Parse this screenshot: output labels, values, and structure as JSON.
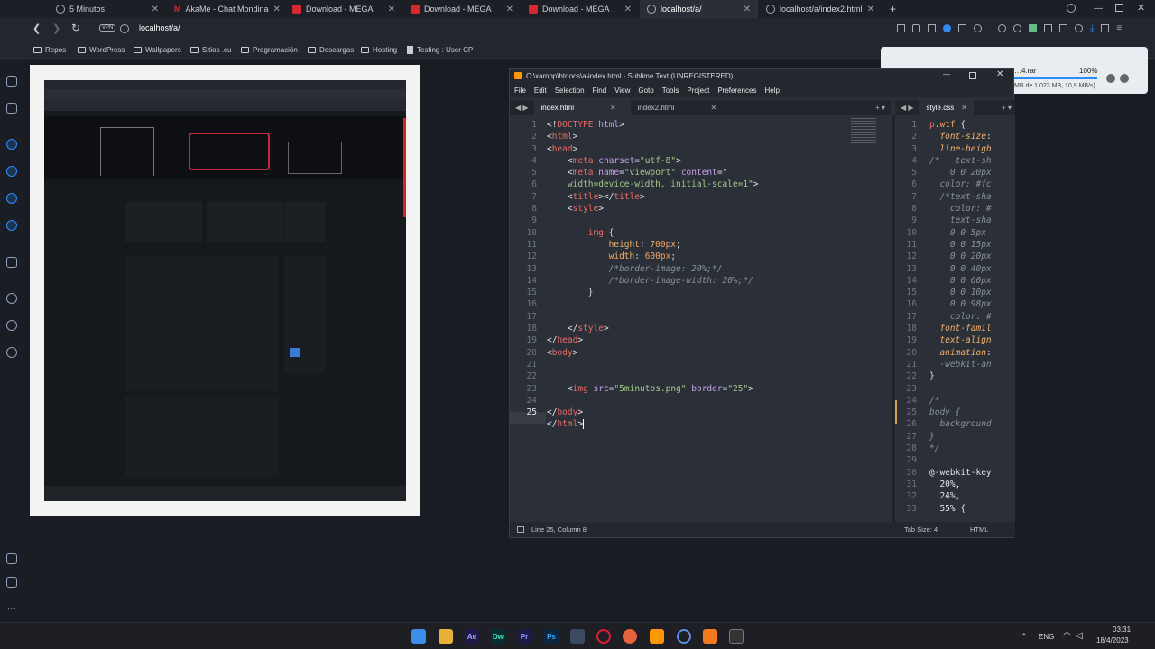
{
  "browser": {
    "tabs": [
      {
        "label": "5 Minutos",
        "icon": "globe-icon"
      },
      {
        "label": "AkaMe - Chat Mondina",
        "icon": "m-logo-icon"
      },
      {
        "label": "Download - MEGA",
        "icon": "mega-icon"
      },
      {
        "label": "Download - MEGA",
        "icon": "mega-icon"
      },
      {
        "label": "Download - MEGA",
        "icon": "mega-icon"
      },
      {
        "label": "localhost/a/",
        "icon": "globe-icon"
      },
      {
        "label": "localhost/a/index2.html",
        "icon": "globe-icon"
      }
    ],
    "new_tab": "+",
    "vpn_label": "VPN",
    "url": "localhost/a/",
    "bookmarks": [
      "Repos",
      "WordPress",
      "Wallpapers",
      "Sitios .cu",
      "Programación",
      "Descargas",
      "Hosting",
      "Testing : User CP"
    ]
  },
  "download": {
    "filename": "…4.rar",
    "percent": "100%",
    "detail": "MB de 1.023 MB, 10,9 MB/s)"
  },
  "sublime": {
    "title": "C:\\xampp\\htdocs\\a\\index.html - Sublime Text (UNREGISTERED)",
    "menu": [
      "File",
      "Edit",
      "Selection",
      "Find",
      "View",
      "Goto",
      "Tools",
      "Project",
      "Preferences",
      "Help"
    ],
    "tabs_left": [
      "index.html",
      "index2.html"
    ],
    "tab_right": "style.css",
    "status_left": "Line 25, Column 8",
    "status_tabsize": "Tab Size: 4",
    "status_syntax": "HTML",
    "left_line_count": 25,
    "right_line_start": 1,
    "right_line_end": 33
  },
  "taskbar": {
    "lang": "ENG",
    "time": "03:31",
    "date": "18/4/2023",
    "apps": [
      "Ae",
      "Dw",
      "Pr",
      "Ps"
    ]
  }
}
